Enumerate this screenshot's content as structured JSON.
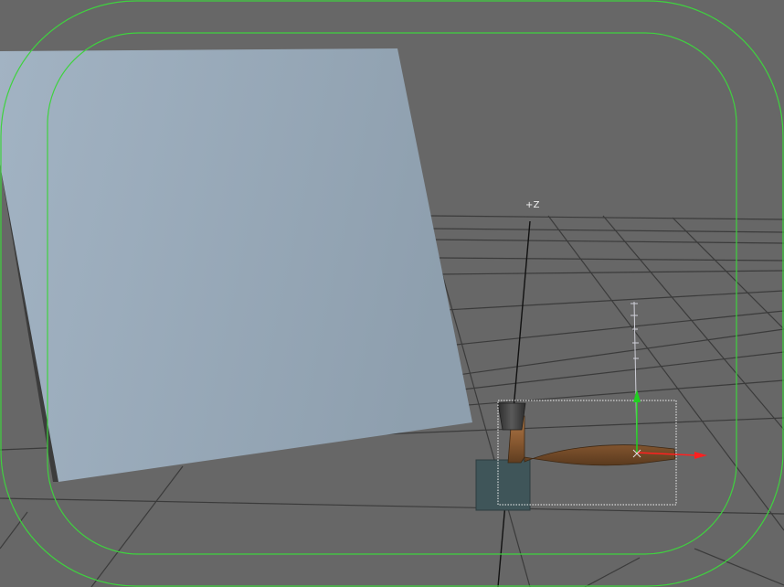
{
  "viewport": {
    "axis_label": "+Z",
    "background_color": "#676767",
    "grid_color": "#3a3a3a",
    "safe_frame_color": "#3fd23f"
  },
  "objects": {
    "wall": {
      "color": "#9aabba"
    },
    "hammer": {
      "handle_color": "#8a5a32",
      "head_color": "#4a4a4a",
      "selection_color": "#ffffff"
    },
    "box": {
      "color": "#3f5559"
    }
  },
  "gizmo": {
    "x_axis_color": "#ff2020",
    "y_axis_color": "#20d020",
    "z_axis_color": "#c8c8d0"
  }
}
